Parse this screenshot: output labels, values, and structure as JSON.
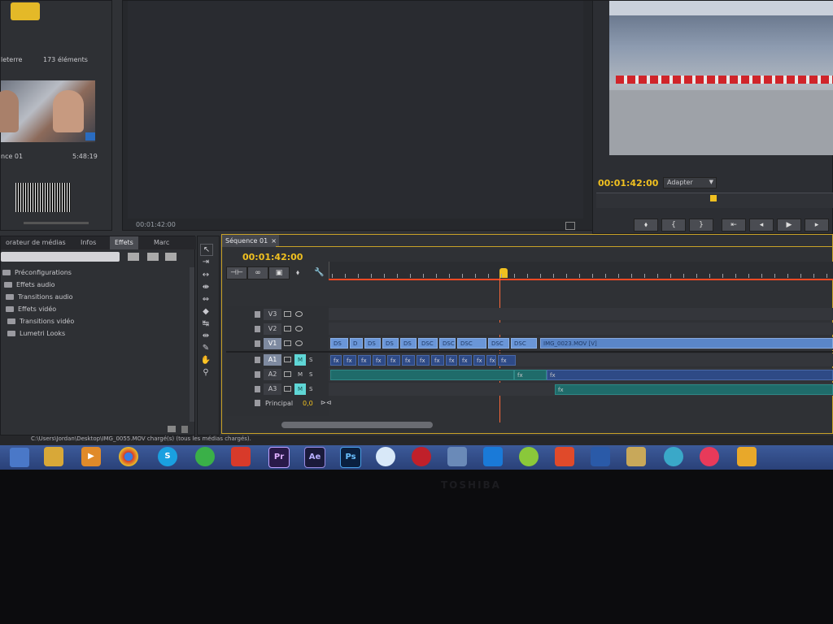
{
  "project_panel": {
    "title_partial": "leterre",
    "item_count": "173 éléments",
    "clip1_name": "nce 01",
    "clip1_duration": "5:48:19"
  },
  "source_monitor": {
    "timecode": "00:01:42:00"
  },
  "program_monitor": {
    "timecode": "00:01:42:00",
    "fit_dropdown": "Adapter"
  },
  "effects_panel": {
    "tabs": [
      "orateur de médias",
      "Infos",
      "Effets",
      "Marc"
    ],
    "active_tab_index": 2,
    "folders": [
      "Préconfigurations",
      "Effets audio",
      "Transitions audio",
      "Effets vidéo",
      "Transitions vidéo",
      "Lumetri Looks"
    ]
  },
  "timeline": {
    "tab_label": "Séquence 01",
    "timecode": "00:01:42:00",
    "video_tracks": [
      "V3",
      "V2",
      "V1"
    ],
    "audio_tracks": [
      "A1",
      "A2",
      "A3"
    ],
    "master_label": "Principal",
    "master_value": "0,0",
    "mute_label": "M",
    "solo_label": "S",
    "v1_clip_labels": [
      "DS",
      "D",
      "DS",
      "DS",
      "DS",
      "DSC",
      "DSC",
      "DSC",
      "DSC",
      "DSC"
    ],
    "v1_long_clip": "IMG_0023.MOV [V]",
    "fx_label": "fx"
  },
  "status_bar": {
    "message": "C:\\Users\\Jordan\\Desktop\\IMG_0055.MOV chargé(s) (tous les médias chargés)."
  },
  "taskbar": {
    "premiere_label": "Pr",
    "after_effects_label": "Ae",
    "photoshop_label": "Ps"
  },
  "monitor_brand": "TOSHIBA",
  "colors": {
    "timecode": "#f0c020",
    "playhead": "#ff5a2a",
    "video_clip": "#5a86c8",
    "audio_clip_blue": "#2e4a86",
    "audio_clip_green": "#1f6b6a"
  }
}
